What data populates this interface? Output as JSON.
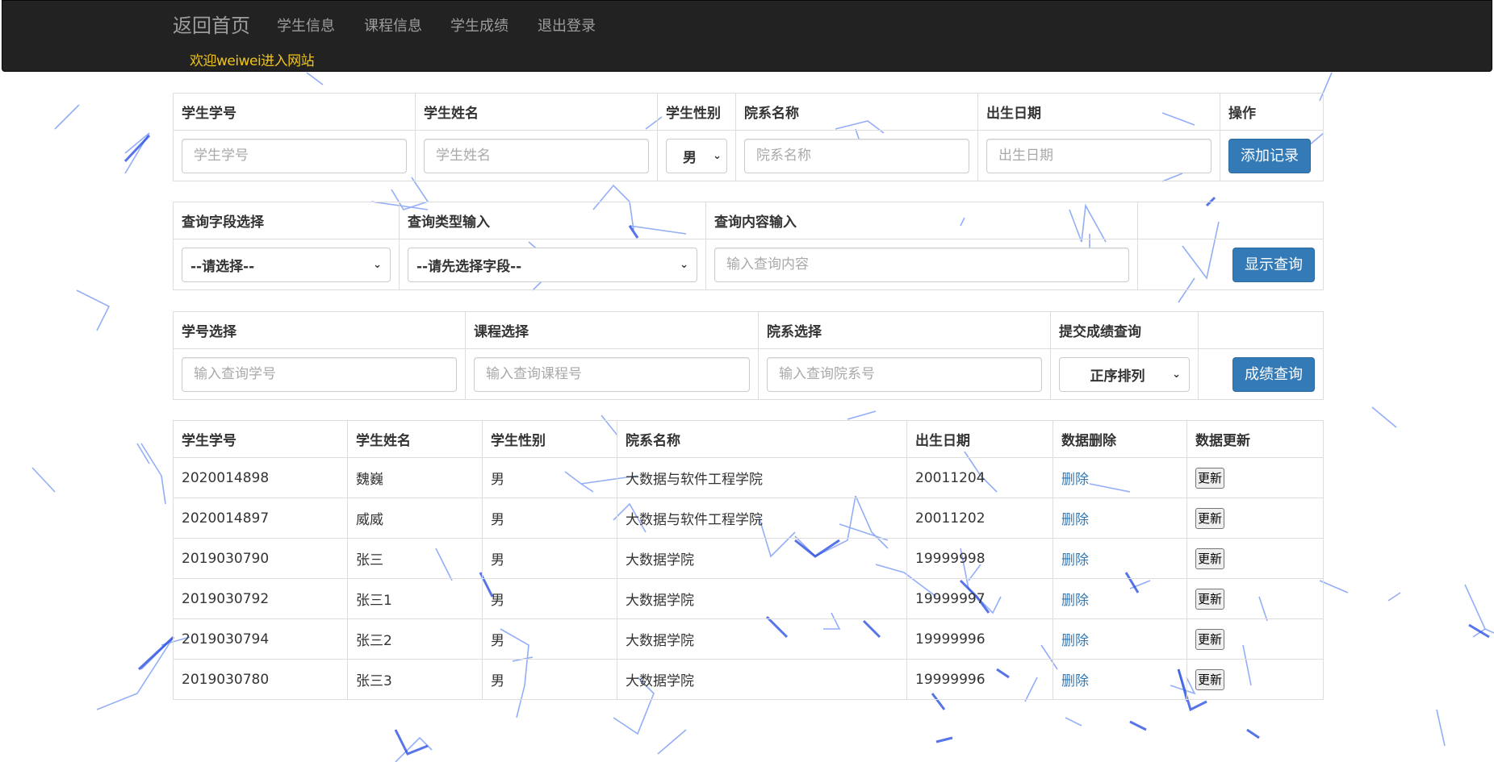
{
  "nav": {
    "brand": "返回首页",
    "links": [
      "学生信息",
      "课程信息",
      "学生成绩",
      "退出登录"
    ],
    "welcome": "欢迎weiwei进入网站"
  },
  "add_form": {
    "headers": [
      "学生学号",
      "学生姓名",
      "学生性别",
      "院系名称",
      "出生日期",
      "操作"
    ],
    "placeholders": {
      "student_id": "学生学号",
      "student_name": "学生姓名",
      "department": "院系名称",
      "birth_date": "出生日期"
    },
    "gender_selected": "男",
    "add_button": "添加记录"
  },
  "query_form": {
    "headers": [
      "查询字段选择",
      "查询类型输入",
      "查询内容输入",
      ""
    ],
    "field_select": "--请选择--",
    "type_select": "--请先选择字段--",
    "content_placeholder": "输入查询内容",
    "show_button": "显示查询"
  },
  "score_form": {
    "headers": [
      "学号选择",
      "课程选择",
      "院系选择",
      "提交成绩查询",
      ""
    ],
    "id_placeholder": "输入查询学号",
    "course_placeholder": "输入查询课程号",
    "dept_placeholder": "输入查询院系号",
    "order_select": "正序排列",
    "query_button": "成绩查询"
  },
  "data_table": {
    "headers": [
      "学生学号",
      "学生姓名",
      "学生性别",
      "院系名称",
      "出生日期",
      "数据删除",
      "数据更新"
    ],
    "rows": [
      {
        "id": "2020014898",
        "name": "魏巍",
        "gender": "男",
        "dept": "大数据与软件工程学院",
        "birth": "20011204",
        "del": "删除",
        "upd": "更新"
      },
      {
        "id": "2020014897",
        "name": "威威",
        "gender": "男",
        "dept": "大数据与软件工程学院",
        "birth": "20011202",
        "del": "删除",
        "upd": "更新"
      },
      {
        "id": "2019030790",
        "name": "张三",
        "gender": "男",
        "dept": "大数据学院",
        "birth": "19999998",
        "del": "删除",
        "upd": "更新"
      },
      {
        "id": "2019030792",
        "name": "张三1",
        "gender": "男",
        "dept": "大数据学院",
        "birth": "19999997",
        "del": "删除",
        "upd": "更新"
      },
      {
        "id": "2019030794",
        "name": "张三2",
        "gender": "男",
        "dept": "大数据学院",
        "birth": "19999996",
        "del": "删除",
        "upd": "更新"
      },
      {
        "id": "2019030780",
        "name": "张三3",
        "gender": "男",
        "dept": "大数据学院",
        "birth": "19999996",
        "del": "删除",
        "upd": "更新"
      }
    ]
  },
  "colors": {
    "navbar_bg": "#222222",
    "nav_text": "#9d9d9d",
    "welcome_text": "#f0c419",
    "primary": "#337ab7",
    "link": "#337ab7",
    "network_lines": "#3b6cf0"
  },
  "icons": [
    "chevron-down-icon"
  ]
}
